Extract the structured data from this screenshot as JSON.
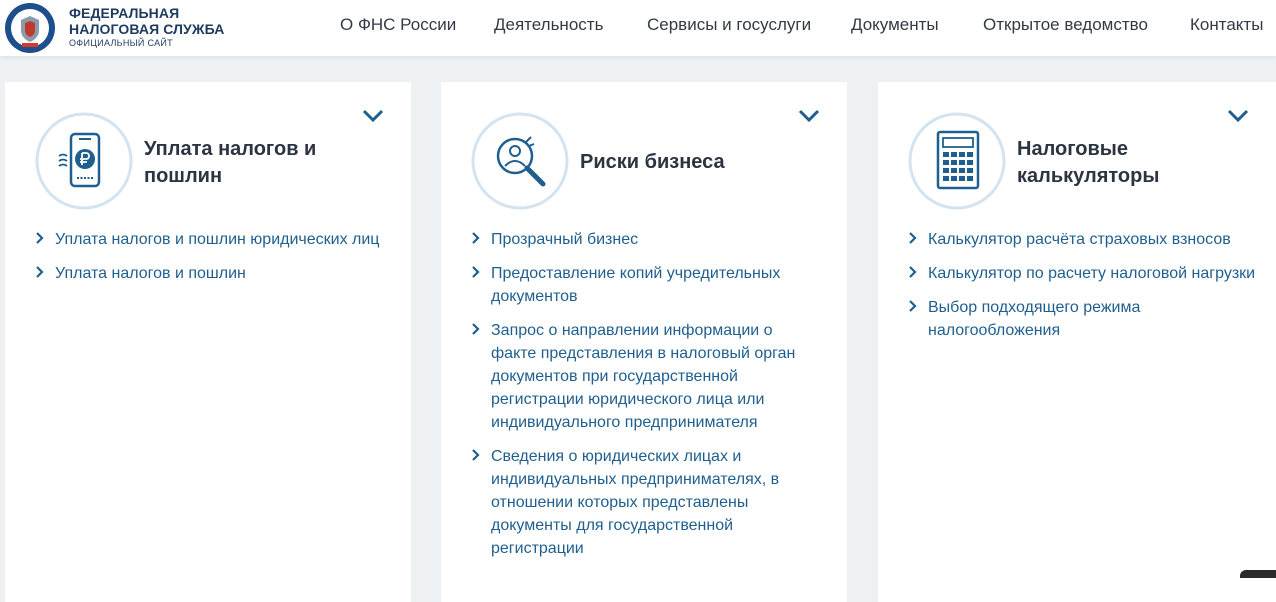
{
  "header": {
    "logo": {
      "line1": "ФЕДЕРАЛЬНАЯ",
      "line2": "НАЛОГОВАЯ СЛУЖБА",
      "line3": "ОФИЦИАЛЬНЫЙ САЙТ",
      "emblem_icon": "fns-emblem-icon"
    },
    "nav": [
      {
        "label": "О ФНС России"
      },
      {
        "label": "Деятельность"
      },
      {
        "label": "Сервисы и госуслуги"
      },
      {
        "label": "Документы"
      },
      {
        "label": "Открытое ведомство"
      },
      {
        "label": "Контакты"
      }
    ]
  },
  "colors": {
    "accent": "#1f5f8f",
    "icon_ring": "#d4e3f0",
    "title": "#2b3440"
  },
  "cards": [
    {
      "title": "Уплата налогов и пошлин",
      "icon": "phone-ruble-icon",
      "links": [
        {
          "label": "Уплата налогов и пошлин юридических лиц"
        },
        {
          "label": "Уплата налогов и пошлин"
        }
      ]
    },
    {
      "title": "Риски бизнеса",
      "icon": "magnifier-person-icon",
      "links": [
        {
          "label": "Прозрачный бизнес"
        },
        {
          "label": "Предоставление копий учредительных документов"
        },
        {
          "label": "Запрос о направлении информации о факте представления в налоговый орган документов при государственной регистрации юридического лица или индивидуального предпринимателя"
        },
        {
          "label": "Сведения о юридических лицах и индивидуальных предпринимателях, в отношении которых представлены документы для государственной регистрации"
        }
      ]
    },
    {
      "title": "Налоговые калькуляторы",
      "icon": "calculator-icon",
      "links": [
        {
          "label": "Калькулятор расчёта страховых взносов"
        },
        {
          "label": "Калькулятор по расчету налоговой нагрузки"
        },
        {
          "label": "Выбор подходящего режима налогообложения"
        }
      ]
    }
  ]
}
